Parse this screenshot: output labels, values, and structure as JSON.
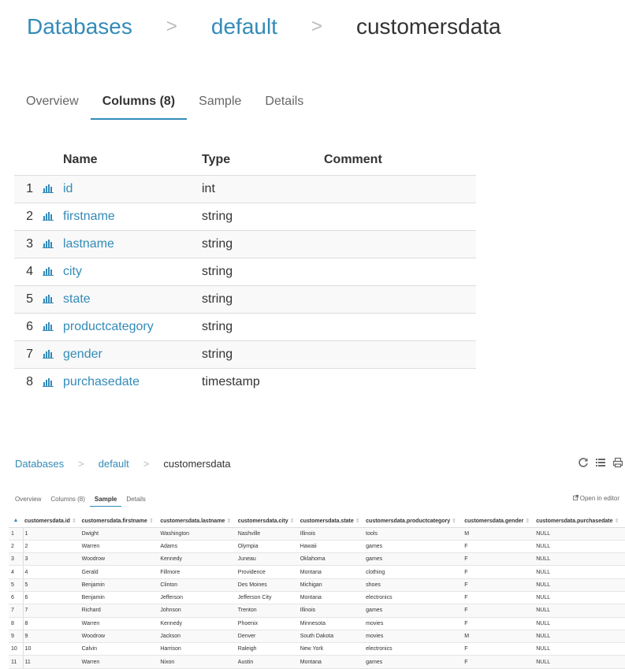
{
  "top": {
    "breadcrumb": {
      "databases": "Databases",
      "sep1": ">",
      "db": "default",
      "sep2": ">",
      "table": "customersdata"
    },
    "tabs": [
      {
        "label": "Overview"
      },
      {
        "label": "Columns (8)"
      },
      {
        "label": "Sample"
      },
      {
        "label": "Details"
      }
    ],
    "columns_table": {
      "headers": {
        "name": "Name",
        "type": "Type",
        "comment": "Comment"
      },
      "rows": [
        {
          "num": "1",
          "name": "id",
          "type": "int"
        },
        {
          "num": "2",
          "name": "firstname",
          "type": "string"
        },
        {
          "num": "3",
          "name": "lastname",
          "type": "string"
        },
        {
          "num": "4",
          "name": "city",
          "type": "string"
        },
        {
          "num": "5",
          "name": "state",
          "type": "string"
        },
        {
          "num": "6",
          "name": "productcategory",
          "type": "string"
        },
        {
          "num": "7",
          "name": "gender",
          "type": "string"
        },
        {
          "num": "8",
          "name": "purchasedate",
          "type": "timestamp"
        }
      ]
    }
  },
  "bottom": {
    "breadcrumb": {
      "databases": "Databases",
      "sep1": ">",
      "db": "default",
      "sep2": ">",
      "table": "customersdata"
    },
    "actions": {
      "refresh": "refresh-icon",
      "list": "list-icon",
      "print": "print-icon"
    },
    "tabs": [
      {
        "label": "Overview"
      },
      {
        "label": "Columns (8)"
      },
      {
        "label": "Sample"
      },
      {
        "label": "Details"
      }
    ],
    "open_in_editor": "Open in editor",
    "sample_table": {
      "headers": [
        "customersdata.id",
        "customersdata.firstname",
        "customersdata.lastname",
        "customersdata.city",
        "customersdata.state",
        "customersdata.productcategory",
        "customersdata.gender",
        "customersdata.purchasedate"
      ],
      "rows": [
        [
          "1",
          "1",
          "Dwight",
          "Washington",
          "Nashville",
          "Illinois",
          "tools",
          "M",
          "NULL"
        ],
        [
          "2",
          "2",
          "Warren",
          "Adams",
          "Olympia",
          "Hawaii",
          "games",
          "F",
          "NULL"
        ],
        [
          "3",
          "3",
          "Woodrow",
          "Kennedy",
          "Juneau",
          "Oklahoma",
          "games",
          "F",
          "NULL"
        ],
        [
          "4",
          "4",
          "Gerald",
          "Fillmore",
          "Providence",
          "Montana",
          "clothing",
          "F",
          "NULL"
        ],
        [
          "5",
          "5",
          "Benjamin",
          "Clinton",
          "Des Moines",
          "Michigan",
          "shoes",
          "F",
          "NULL"
        ],
        [
          "6",
          "6",
          "Benjamin",
          "Jefferson",
          "Jefferson City",
          "Montana",
          "electronics",
          "F",
          "NULL"
        ],
        [
          "7",
          "7",
          "Richard",
          "Johnson",
          "Trenton",
          "Illinois",
          "games",
          "F",
          "NULL"
        ],
        [
          "8",
          "8",
          "Warren",
          "Kennedy",
          "Phoenix",
          "Minnesota",
          "movies",
          "F",
          "NULL"
        ],
        [
          "9",
          "9",
          "Woodrow",
          "Jackson",
          "Denver",
          "South Dakota",
          "movies",
          "M",
          "NULL"
        ],
        [
          "10",
          "10",
          "Calvin",
          "Harrison",
          "Raleigh",
          "New York",
          "electronics",
          "F",
          "NULL"
        ],
        [
          "11",
          "11",
          "Warren",
          "Nixon",
          "Austin",
          "Montana",
          "games",
          "F",
          "NULL"
        ]
      ]
    }
  }
}
